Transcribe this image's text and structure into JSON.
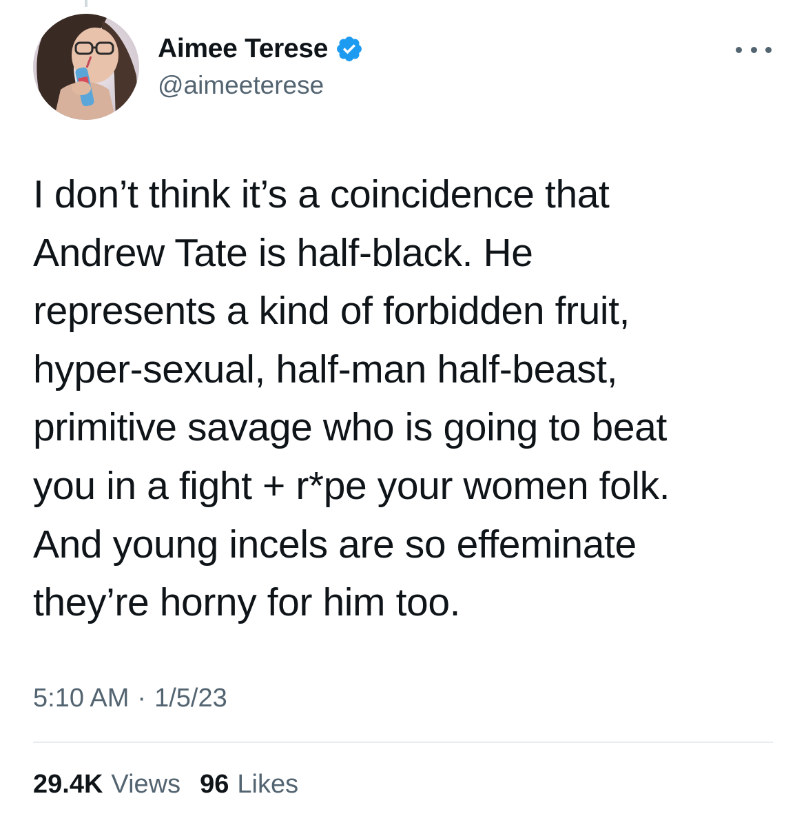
{
  "author": {
    "display_name": "Aimee Terese",
    "handle": "@aimeeterese",
    "verified": true,
    "verified_color": "#1d9bf0"
  },
  "tweet": {
    "lines": [
      "I don’t think it’s a coincidence that",
      "Andrew Tate is half-black. He",
      "represents a kind of forbidden fruit,",
      "hyper-sexual, half-man half-beast,",
      "primitive savage who is going to beat",
      "you in a fight + r*pe your women folk.",
      "And young incels are so effeminate",
      "they’re horny for him too."
    ],
    "time": "5:10 AM",
    "separator": "·",
    "date": "1/5/23"
  },
  "stats": {
    "views_count": "29.4K",
    "views_label": "Views",
    "likes_count": "96",
    "likes_label": "Likes"
  },
  "icons": {
    "more": "more-horizontal-icon",
    "verified": "verified-badge-icon"
  }
}
